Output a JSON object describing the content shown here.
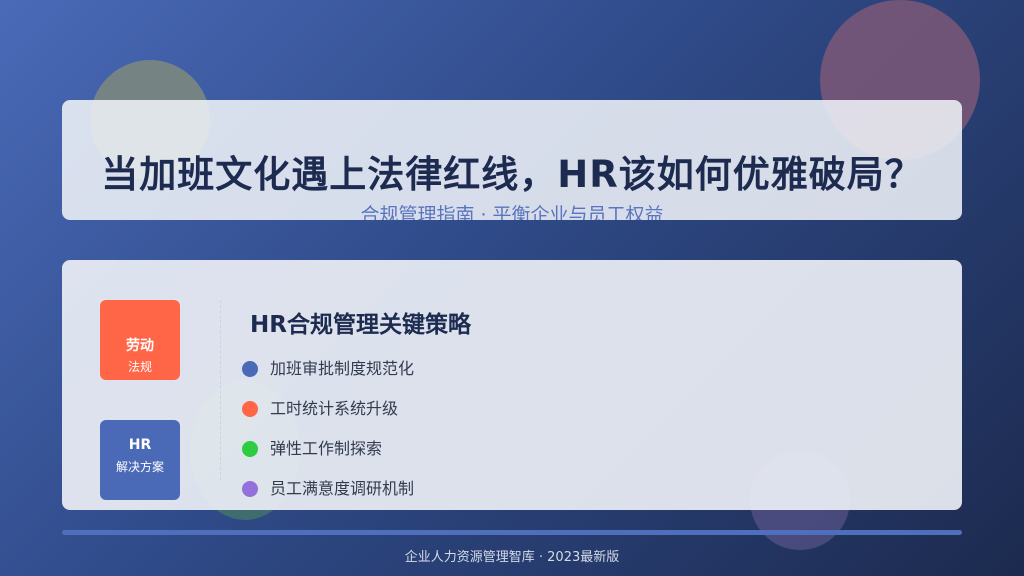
{
  "header": {
    "title": "当加班文化遇上法律红线，HR该如何优雅破局？",
    "subtitle": "合规管理指南 · 平衡企业与员工权益"
  },
  "tags": [
    {
      "main": "劳动",
      "sub": "法规",
      "color": "#ff6547"
    },
    {
      "main": "HR",
      "sub": "解决方案",
      "color": "#4a6ab8"
    }
  ],
  "strategy": {
    "title": "HR合规管理关键策略",
    "items": [
      {
        "label": "加班审批制度规范化",
        "color": "#4a6ab8"
      },
      {
        "label": "工时统计系统升级",
        "color": "#ff6547"
      },
      {
        "label": "弹性工作制探索",
        "color": "#2ecc40"
      },
      {
        "label": "员工满意度调研机制",
        "color": "#9370db"
      }
    ]
  },
  "footer": {
    "text": "企业人力资源管理智库 · 2023最新版"
  }
}
